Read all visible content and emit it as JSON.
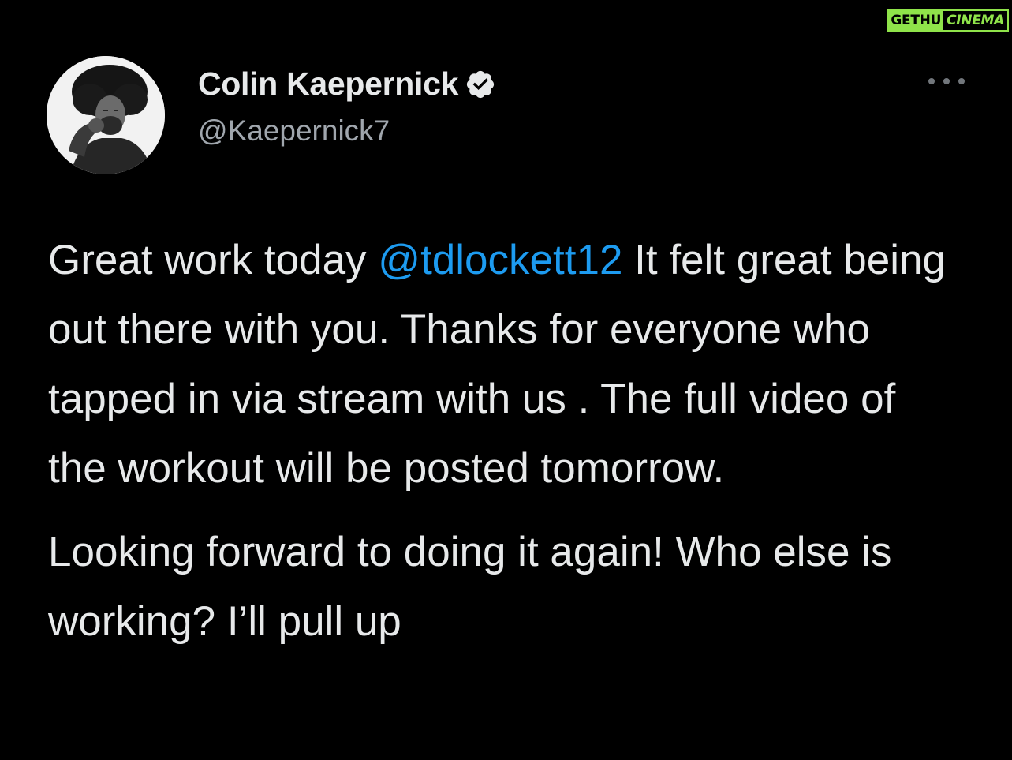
{
  "watermark": {
    "part1": "GETHU",
    "part2": "CINEMA",
    "accent": "#8fe34a"
  },
  "tweet": {
    "author": {
      "display_name": "Colin Kaepernick",
      "handle": "@Kaepernick7",
      "verified": true,
      "avatar_icon": "profile-photo"
    },
    "menu_icon": "more-horizontal-icon",
    "paragraph1": {
      "before_mention": "Great work today ",
      "mention": "@tdlockett12",
      "after_mention": " It felt great being out there with you. Thanks for everyone who tapped in via stream with us . The full video of the workout will be posted tomorrow."
    },
    "paragraph2": "Looking forward to doing it again! Who else is working? I’ll pull up"
  },
  "colors": {
    "background": "#000000",
    "text": "#e7e9ea",
    "secondary_text": "#a0a6ad",
    "mention": "#1d9bf0"
  }
}
